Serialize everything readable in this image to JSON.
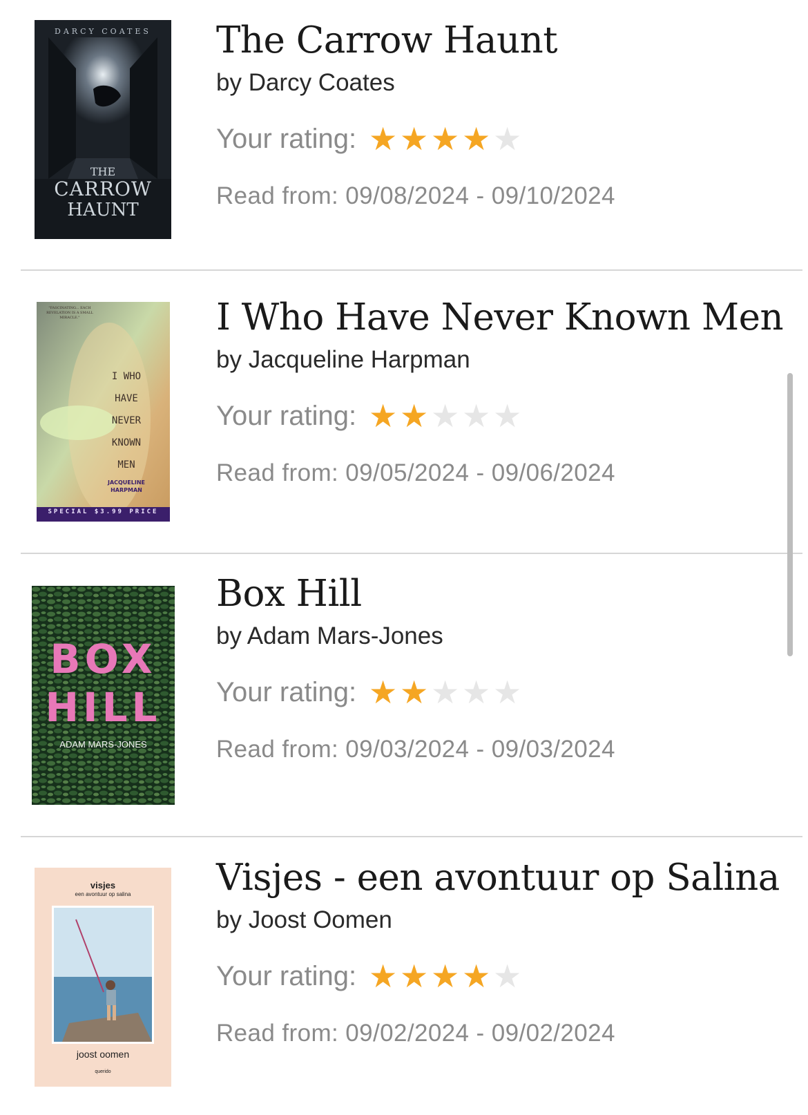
{
  "colors": {
    "star_filled": "#F5A623",
    "star_empty": "#E6E6E6",
    "divider": "#D6D6D6"
  },
  "books": [
    {
      "title": "The Carrow Haunt",
      "author": "by Darcy Coates",
      "rating_label": "Your rating:",
      "rating": 4,
      "rating_max": 5,
      "read_from": "Read from: 09/08/2024 - 09/10/2024",
      "cover": {
        "author_text": "DARCY COATES",
        "title_line1": "THE",
        "title_line2": "CARROW",
        "title_line3": "HAUNT"
      }
    },
    {
      "title": "I Who Have Never Known Men",
      "author": "by Jacqueline Harpman",
      "rating_label": "Your rating:",
      "rating": 2,
      "rating_max": 5,
      "read_from": "Read from: 09/05/2024 - 09/06/2024",
      "cover": {
        "quote": "\"FASCINATING... EACH REVELATION IS A SMALL MIRACLE.\"",
        "title_words": [
          "I WHO",
          "HAVE",
          "NEVER",
          "KNOWN",
          "MEN"
        ],
        "author_text": "JACQUELINE HARPMAN",
        "banner": "SPECIAL $3.99 PRICE"
      }
    },
    {
      "title": "Box Hill",
      "author": "by Adam Mars-Jones",
      "rating_label": "Your rating:",
      "rating": 2,
      "rating_max": 5,
      "read_from": "Read from: 09/03/2024 - 09/03/2024",
      "cover": {
        "title_line1": "BOX",
        "title_line2": "HILL",
        "author_text": "ADAM MARS-JONES"
      }
    },
    {
      "title": "Visjes - een avontuur op Salina",
      "author": "by Joost Oomen",
      "rating_label": "Your rating:",
      "rating": 4,
      "rating_max": 5,
      "read_from": "Read from: 09/02/2024 - 09/02/2024",
      "cover": {
        "title_text": "visjes",
        "subtitle_text": "een avontuur op salina",
        "author_text": "joost oomen",
        "publisher_text": "querido"
      }
    }
  ]
}
